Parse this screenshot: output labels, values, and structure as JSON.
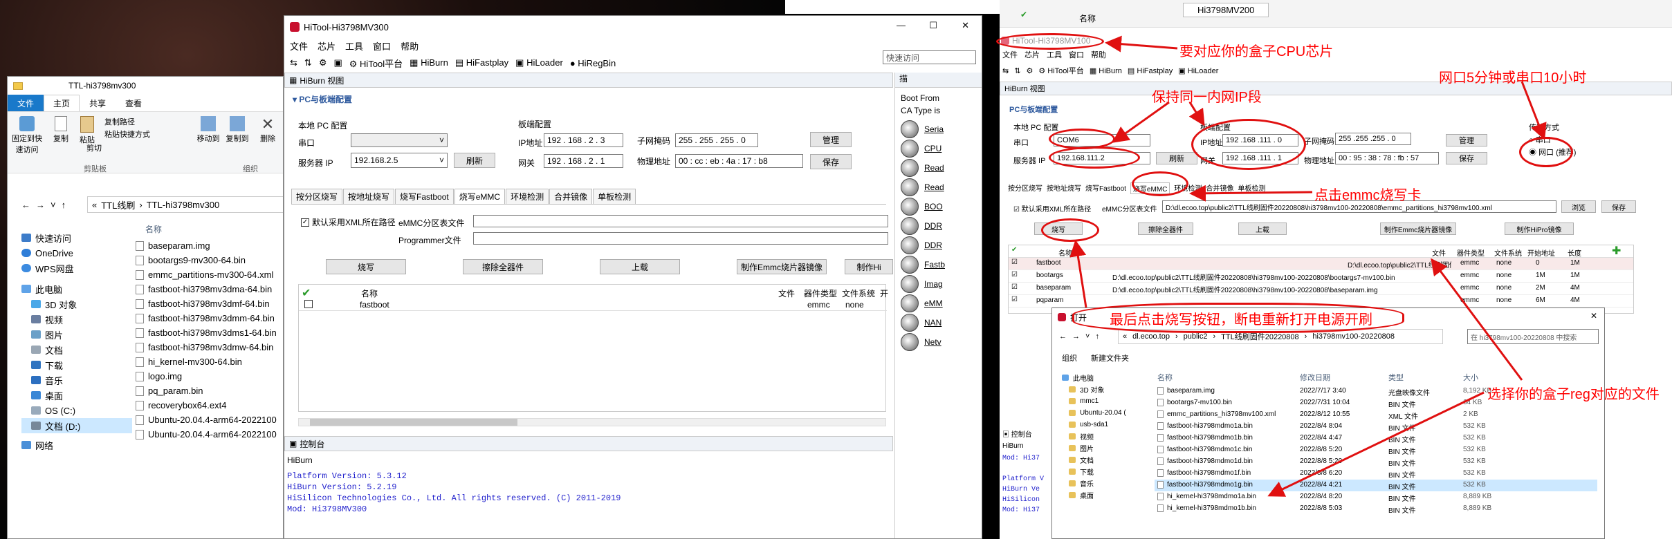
{
  "explorer": {
    "title": "TTL-hi3798mv300",
    "ribbon_tabs": [
      "文件",
      "主页",
      "共享",
      "查看"
    ],
    "ribbon_items": [
      "固定到快速访问",
      "复制",
      "粘贴",
      "复制路径",
      "粘贴快捷方式",
      "剪切",
      "移动到",
      "复制到",
      "删除"
    ],
    "group_labels": [
      "剪贴板",
      "组织"
    ],
    "path": [
      "TTL线刷",
      "TTL-hi3798mv300"
    ],
    "nav": [
      "快速访问",
      "OneDrive",
      "WPS网盘",
      "此电脑",
      "3D 对象",
      "视频",
      "图片",
      "文档",
      "下载",
      "音乐",
      "桌面",
      "OS (C:)",
      "文档 (D:)",
      "网络"
    ],
    "col_name": "名称",
    "files": [
      "baseparam.img",
      "bootargs9-mv300-64.bin",
      "emmc_partitions-mv300-64.xml",
      "fastboot-hi3798mv3dma-64.bin",
      "fastboot-hi3798mv3dmf-64.bin",
      "fastboot-hi3798mv3dmm-64.bin",
      "fastboot-hi3798mv3dms1-64.bin",
      "fastboot-hi3798mv3dmw-64.bin",
      "hi_kernel-mv300-64.bin",
      "logo.img",
      "pq_param.bin",
      "recoverybox64.ext4",
      "Ubuntu-20.04.4-arm64-2022100",
      "Ubuntu-20.04.4-arm64-2022100"
    ]
  },
  "hitool1": {
    "title": "HiTool-Hi3798MV300",
    "menu": [
      "文件",
      "芯片",
      "工具",
      "窗口",
      "帮助"
    ],
    "toolbar": [
      "HiTool平台",
      "HiBurn",
      "HiFastplay",
      "HiLoader",
      "HiRegBin"
    ],
    "quick_access": "快速访问",
    "view_title": "HiBurn 视图",
    "section_title": "PC与板端配置",
    "local_pc": "本地 PC 配置",
    "port_label": "串口",
    "server_ip_label": "服务器 IP",
    "server_ip": "192.168.2.5",
    "refresh": "刷新",
    "board_cfg": "板端配置",
    "ip_label": "IP地址",
    "ip_value": "192 . 168 . 2 . 3",
    "mask_label": "子网掩码",
    "mask_value": "255 . 255 . 255 . 0",
    "gw_label": "网关",
    "gw_value": "192 . 168 . 2 . 1",
    "mac_label": "物理地址",
    "mac_value": "00 : cc : eb : 4a : 17 : b8",
    "manage": "管理",
    "save": "保存",
    "tabs": [
      "按分区烧写",
      "按地址烧写",
      "烧写Fastboot",
      "烧写eMMC",
      "环境检测",
      "合并镜像",
      "单板检测"
    ],
    "use_xml": "默认采用XML所在路径",
    "emmc_file": "eMMC分区表文件",
    "programmer": "Programmer文件",
    "actions": [
      "烧写",
      "擦除全器件",
      "上载",
      "制作Emmc烧片器镜像",
      "制作Hi"
    ],
    "grid_headers": [
      "名称",
      "文件",
      "器件类型",
      "文件系统",
      "开"
    ],
    "grid_row": [
      "fastboot",
      "emmc",
      "none"
    ],
    "console_title": "控制台",
    "console_sub": "HiBurn",
    "console_lines": [
      "Platform Version: 5.3.12",
      "HiBurn Version: 5.2.19",
      "HiSilicon Technologies Co., Ltd. All rights reserved. (C) 2011-2019",
      "Mod: Hi3798MV300"
    ],
    "side_title": "描",
    "side_header": [
      "Boot From",
      "CA Type is"
    ],
    "side_items": [
      "Seria",
      "CPU",
      "Read",
      "Read",
      "BOO",
      "DDR",
      "DDR",
      "Fastb",
      "Imag",
      "eMM",
      "NAN",
      "Netv"
    ]
  },
  "hitool2": {
    "title": "HiTool-Hi3798MV100",
    "top_chip": "Hi3798MV200",
    "top_col": "名称",
    "menu": [
      "文件",
      "芯片",
      "工具",
      "窗口",
      "帮助"
    ],
    "toolbar": [
      "HiTool平台",
      "HiBurn",
      "HiFastplay",
      "HiLoader"
    ],
    "view_title": "HiBurn 视图",
    "section_title": "PC与板端配置",
    "local_pc": "本地 PC 配置",
    "port_label": "串口",
    "port_value": "COM6",
    "server_ip_label": "服务器 IP",
    "server_ip": "192.168.111.2",
    "refresh": "刷新",
    "board_cfg": "板端配置",
    "ip_label": "IP地址",
    "ip_value": "192 .168 .111 . 0",
    "mask_label": "子网掩码",
    "mask_value": "255 .255 .255 . 0",
    "gw_label": "网关",
    "gw_value": "192 .168 .111 . 1",
    "mac_label": "物理地址",
    "mac_value": "00 : 95 : 38 : 78 : fb : 57",
    "manage": "管理",
    "save": "保存",
    "transfer": "传输方式",
    "serial": "串口",
    "net": "网口 (推荐)",
    "tabs": [
      "按分区烧写",
      "按地址烧写",
      "烧写Fastboot",
      "烧写eMMC",
      "环境检测",
      "合并镜像",
      "单板检测"
    ],
    "use_xml": "默认采用XML所在路径",
    "emmc_file": "eMMC分区表文件",
    "xml_path": "D:\\dl.ecoo.top\\public2\\TTL线刷固件20220808\\hi3798mv100-20220808\\emmc_partitions_hi3798mv100.xml",
    "browse": "浏览",
    "save2": "保存",
    "actions": [
      "烧写",
      "擦除全器件",
      "上载",
      "制作Emmc烧片器镜像",
      "制作HiPro镜像"
    ],
    "grid_headers": [
      "名称",
      "文件",
      "器件类型",
      "文件系统",
      "开始地址",
      "长度"
    ],
    "rows": [
      [
        "fastboot",
        "D:\\dl.ecoo.top\\public2\\TTL线刷固件",
        "emmc",
        "none",
        "0",
        "1M"
      ],
      [
        "bootargs",
        "D:\\dl.ecoo.top\\public2\\TTL线刷固件20220808\\hi3798mv100-20220808\\bootargs7-mv100.bin",
        "emmc",
        "none",
        "1M",
        "1M"
      ],
      [
        "baseparam",
        "D:\\dl.ecoo.top\\public2\\TTL线刷固件20220808\\hi3798mv100-20220808\\baseparam.img",
        "emmc",
        "none",
        "2M",
        "4M"
      ],
      [
        "pqparam",
        "",
        "emmc",
        "none",
        "6M",
        "4M"
      ]
    ],
    "console_title": "控制台",
    "console_sub": "HiBurn",
    "console_lines": [
      "Mod: Hi37",
      "",
      "Platform V",
      "HiBurn Ve",
      "HiSilicon",
      "Mod: Hi37"
    ]
  },
  "open_dialog": {
    "title": "打开",
    "path": [
      "dl.ecoo.top",
      "public2",
      "TTL线刷固件20220808",
      "hi3798mv100-20220808"
    ],
    "search": "在 hi3798mv100-20220808 中搜索",
    "organize": "组织",
    "new_folder": "新建文件夹",
    "nav": [
      "此电脑",
      "3D 对象",
      "mmc1",
      "Ubuntu-20.04 (",
      "usb-sda1",
      "视频",
      "图片",
      "文档",
      "下载",
      "音乐",
      "桌面"
    ],
    "headers": [
      "名称",
      "修改日期",
      "类型",
      "大小"
    ],
    "files": [
      [
        "baseparam.img",
        "2022/7/17 3:40",
        "光盘映像文件",
        "8,192 KB"
      ],
      [
        "bootargs7-mv100.bin",
        "2022/7/31 10:04",
        "BIN 文件",
        "64 KB"
      ],
      [
        "emmc_partitions_hi3798mv100.xml",
        "2022/8/12 10:55",
        "XML 文件",
        "2 KB"
      ],
      [
        "fastboot-hi3798mdmo1a.bin",
        "2022/8/4 8:04",
        "BIN 文件",
        "532 KB"
      ],
      [
        "fastboot-hi3798mdmo1b.bin",
        "2022/8/4 4:47",
        "BIN 文件",
        "532 KB"
      ],
      [
        "fastboot-hi3798mdmo1c.bin",
        "2022/8/8 5:20",
        "BIN 文件",
        "532 KB"
      ],
      [
        "fastboot-hi3798mdmo1d.bin",
        "2022/8/8 5:20",
        "BIN 文件",
        "532 KB"
      ],
      [
        "fastboot-hi3798mdmo1f.bin",
        "2022/8/8 6:20",
        "BIN 文件",
        "532 KB"
      ],
      [
        "fastboot-hi3798mdmo1g.bin",
        "2022/8/4 4:21",
        "BIN 文件",
        "532 KB"
      ],
      [
        "hi_kernel-hi3798mdmo1a.bin",
        "2022/8/4 8:20",
        "BIN 文件",
        "8,889 KB"
      ],
      [
        "hi_kernel-hi3798mdmo1b.bin",
        "2022/8/8 5:03",
        "BIN 文件",
        "8,889 KB"
      ]
    ]
  },
  "annotations": {
    "cpu": "要对应你的盒子CPU芯片",
    "lan": "保持同一内网IP段",
    "mode": "网口5分钟或串口10小时",
    "emmc": "点击emmc烧写卡",
    "burn": "最后点击烧写按钮，断电重新打开电源开刷",
    "reg": "选择你的盒子reg对应的文件"
  },
  "colors": {
    "accent": "#0078d7",
    "annotation": "#ff0000",
    "console_blue": "#0000cc"
  }
}
